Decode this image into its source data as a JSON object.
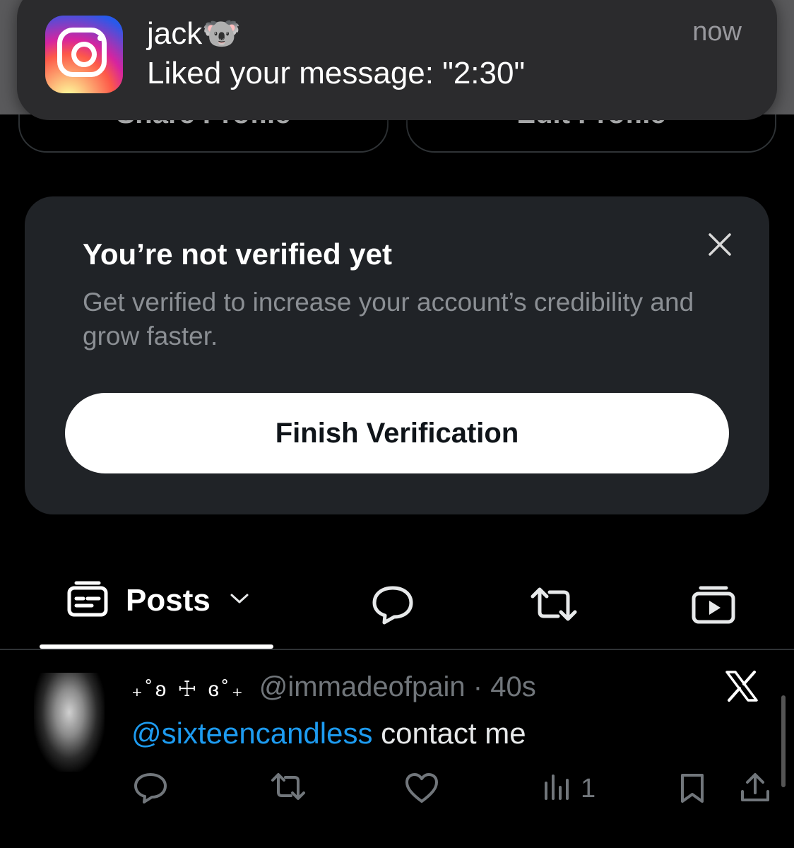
{
  "notification": {
    "app_icon": "instagram-icon",
    "sender": "jack🐨",
    "message": "Liked your message: \"2:30\"",
    "time": "now"
  },
  "profile": {
    "share_label": "Share Profile",
    "edit_label": "Edit Profile"
  },
  "verification": {
    "title": "You’re not verified yet",
    "description": "Get verified to increase your account’s credibility and grow faster.",
    "button_label": "Finish Verification",
    "close_icon": "close-icon"
  },
  "tabs": {
    "posts_label": "Posts",
    "icons": [
      "posts-icon",
      "replies-icon",
      "reposts-icon",
      "media-icon"
    ]
  },
  "post": {
    "display_name": "₊˚ʚ ☩ ɞ˚₊",
    "handle": "@immadeofpain",
    "separator": "·",
    "time": "40s",
    "mention": "@sixteencandless",
    "text": " contact me",
    "views": "1"
  },
  "colors": {
    "background": "#000000",
    "card": "#202327",
    "accent_link": "#1d9bf0",
    "muted": "#71767b"
  }
}
